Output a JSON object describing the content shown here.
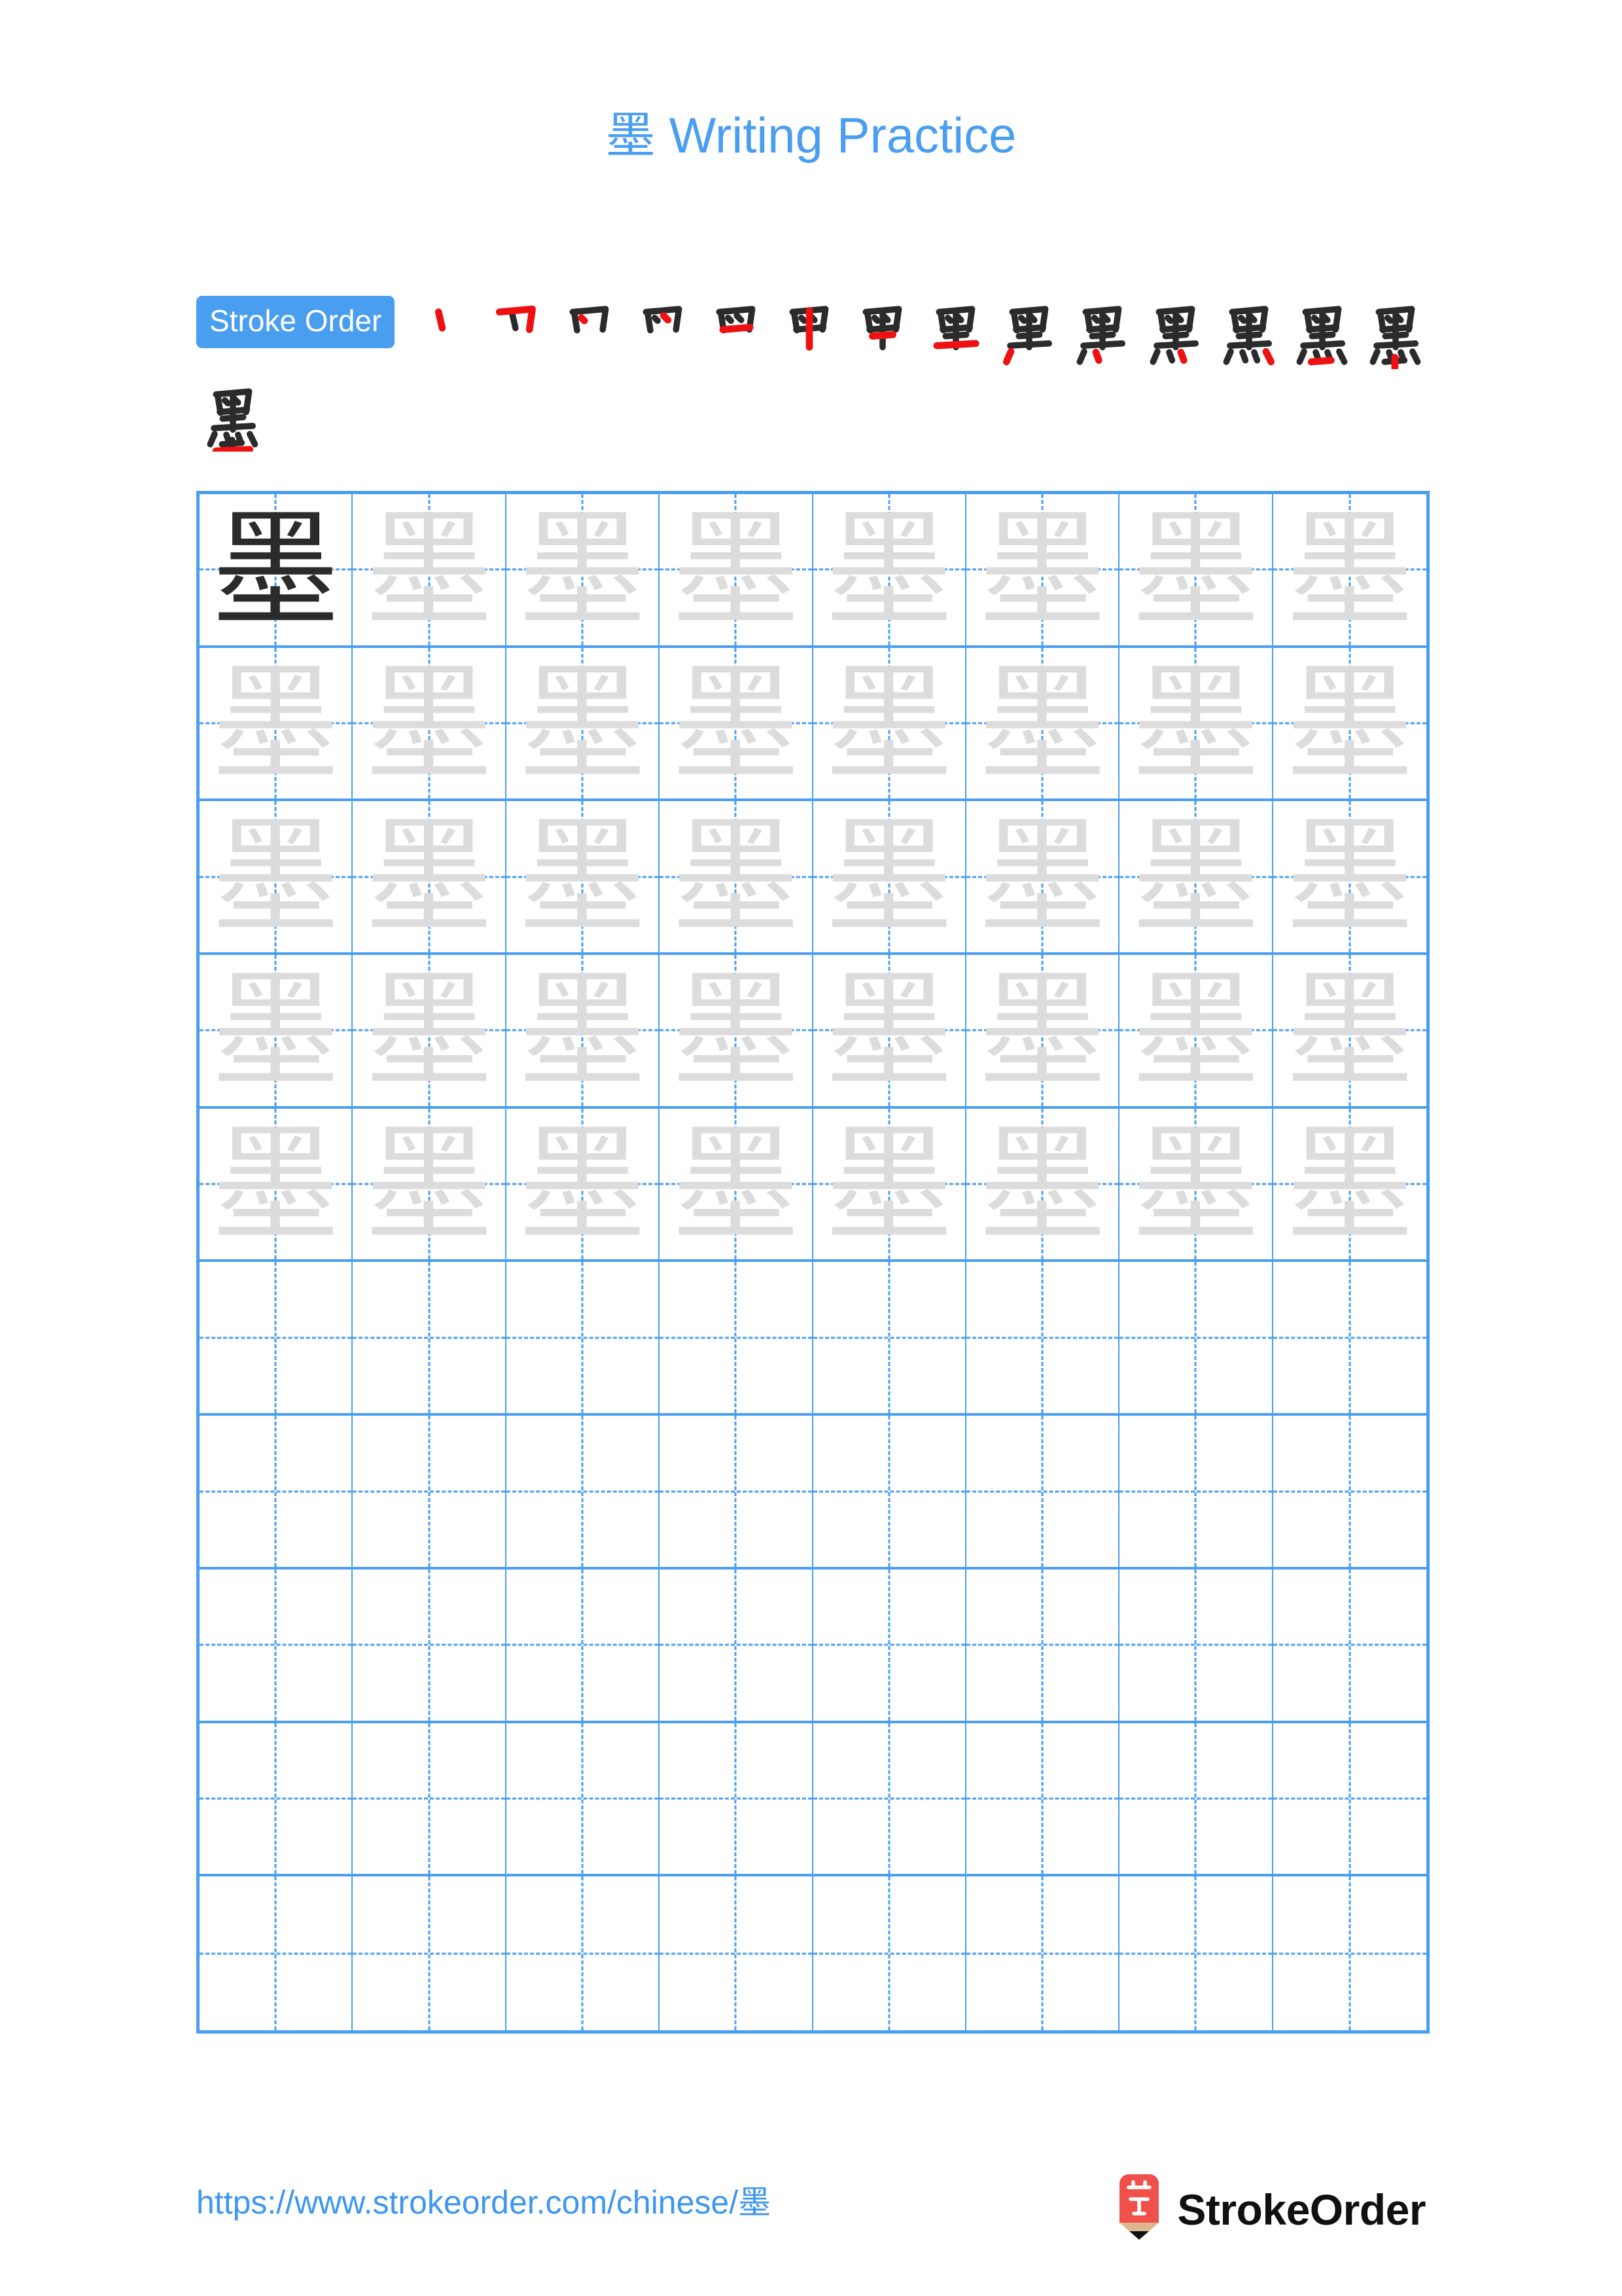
{
  "page": {
    "background": "#ffffff",
    "accent_blue": "#4a9ef0",
    "stroke_new_red": "#ee1111",
    "trace_gray": "#dcdcdc",
    "model_black": "#2b2b2b"
  },
  "header": {
    "character": "墨",
    "title_suffix": " Writing Practice",
    "full_title": "墨 Writing Practice"
  },
  "stroke_order": {
    "badge_label": "Stroke Order",
    "total_strokes": 15,
    "character": "墨",
    "steps": [
      {
        "index": 1,
        "partial": "丶"
      },
      {
        "index": 2,
        "partial": "冂"
      },
      {
        "index": 3,
        "partial": "冂"
      },
      {
        "index": 4,
        "partial": "冈"
      },
      {
        "index": 5,
        "partial": "四"
      },
      {
        "index": 6,
        "partial": "甲"
      },
      {
        "index": 7,
        "partial": "甲"
      },
      {
        "index": 8,
        "partial": "里"
      },
      {
        "index": 9,
        "partial": "里"
      },
      {
        "index": 10,
        "partial": "黒"
      },
      {
        "index": 11,
        "partial": "黑"
      },
      {
        "index": 12,
        "partial": "黑"
      },
      {
        "index": 13,
        "partial": "黑"
      },
      {
        "index": 14,
        "partial": "墨"
      },
      {
        "index": 15,
        "partial": "墨"
      }
    ]
  },
  "practice_grid": {
    "columns": 8,
    "rows": 10,
    "character": "墨",
    "filled_rows": 5,
    "model_cell": {
      "row": 1,
      "column": 1
    },
    "cells": [
      [
        "墨",
        "墨",
        "墨",
        "墨",
        "墨",
        "墨",
        "墨",
        "墨"
      ],
      [
        "墨",
        "墨",
        "墨",
        "墨",
        "墨",
        "墨",
        "墨",
        "墨"
      ],
      [
        "墨",
        "墨",
        "墨",
        "墨",
        "墨",
        "墨",
        "墨",
        "墨"
      ],
      [
        "墨",
        "墨",
        "墨",
        "墨",
        "墨",
        "墨",
        "墨",
        "墨"
      ],
      [
        "墨",
        "墨",
        "墨",
        "墨",
        "墨",
        "墨",
        "墨",
        "墨"
      ],
      [
        "",
        "",
        "",
        "",
        "",
        "",
        "",
        ""
      ],
      [
        "",
        "",
        "",
        "",
        "",
        "",
        "",
        ""
      ],
      [
        "",
        "",
        "",
        "",
        "",
        "",
        "",
        ""
      ],
      [
        "",
        "",
        "",
        "",
        "",
        "",
        "",
        ""
      ],
      [
        "",
        "",
        "",
        "",
        "",
        "",
        "",
        ""
      ]
    ]
  },
  "footer": {
    "url": "https://www.strokeorder.com/chinese/墨",
    "brand_name": "StrokeOrder",
    "logo_character": "字",
    "logo_body_color": "#f0504a",
    "logo_wood_color": "#ddb88e",
    "logo_tip_color": "#111111"
  }
}
